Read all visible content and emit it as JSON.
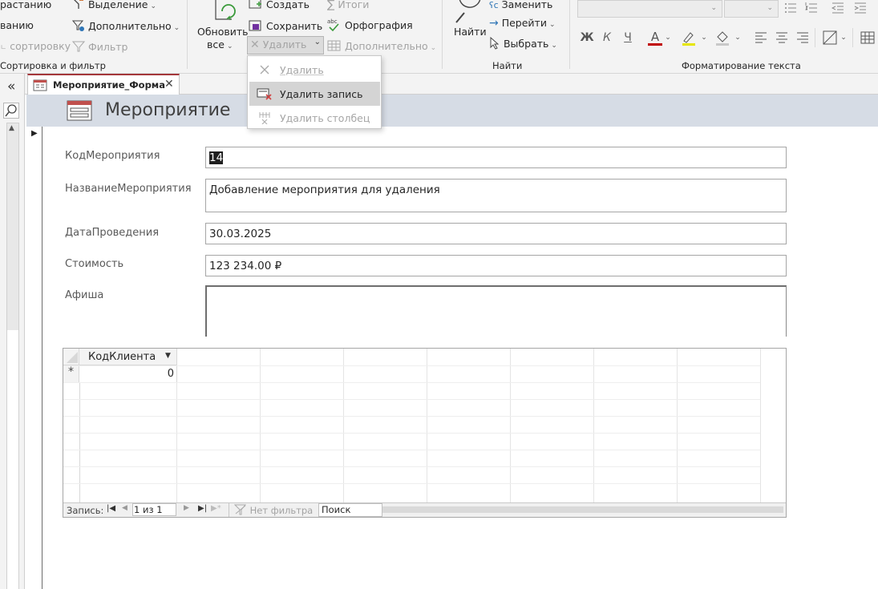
{
  "ribbon": {
    "sort_filter": {
      "ascending_label": "растанию",
      "descending_label": "ванию",
      "remove_sort_label": "сортировку",
      "selection_label": "Выделение",
      "advanced_label": "Дополнительно",
      "filter_label": "Фильтр",
      "group_label": "Сортировка и фильтр"
    },
    "records": {
      "refresh_label_1": "Обновить",
      "refresh_label_2": "все",
      "create_label": "Создать",
      "save_label": "Сохранить",
      "delete_label": "Удалить",
      "totals_label": "Итоги",
      "spelling_label": "Орфография",
      "more_label": "Дополнительно"
    },
    "find": {
      "find_label": "Найти",
      "replace_label": "Заменить",
      "goto_label": "Перейти",
      "select_label": "Выбрать",
      "group_label": "Найти"
    },
    "text_format": {
      "bold": "Ж",
      "italic": "К",
      "underline": "Ч",
      "font_color_letter": "A",
      "group_label": "Форматирование текста"
    }
  },
  "delete_menu": {
    "items": [
      {
        "label": "Удалить",
        "icon": "x-icon",
        "enabled": false
      },
      {
        "label": "Удалить запись",
        "icon": "delete-record-icon",
        "enabled": true
      },
      {
        "label": "Удалить столбец",
        "icon": "delete-column-icon",
        "enabled": false
      }
    ]
  },
  "nav_pane": {
    "collapse_glyph": "«"
  },
  "document_tab": {
    "title": "Мероприятие_Форма"
  },
  "form": {
    "header_title": "Мероприятие",
    "fields": {
      "id": {
        "label": "КодМероприятия",
        "value": "14"
      },
      "name": {
        "label": "НазваниеМероприятия",
        "value": "Добавление мероприятия для удаления"
      },
      "date": {
        "label": "ДатаПроведения",
        "value": "30.03.2025"
      },
      "cost": {
        "label": "Стоимость",
        "value": "123 234.00 ₽"
      },
      "poster": {
        "label": "Афиша",
        "value": ""
      }
    },
    "subform": {
      "column_header": "КодКлиента",
      "new_row_marker": "*",
      "new_row_value": "0",
      "nav": {
        "record_label": "Запись:",
        "position": "1 из 1",
        "filter_label": "Нет фильтра",
        "search_label": "Поиск"
      }
    }
  },
  "colors": {
    "header_band": "#d6dce5",
    "tab_accent": "#a4373a",
    "menu_highlight": "#d4d4d4"
  }
}
